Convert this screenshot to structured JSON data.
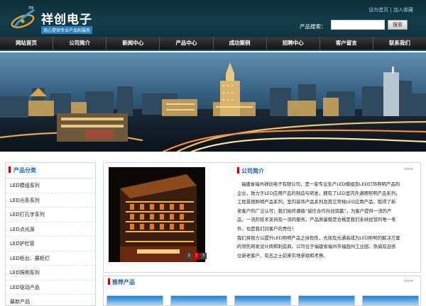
{
  "brand": {
    "name": "祥创电子",
    "slogan": "用心提供专业产品和服务",
    "tm": "TM",
    "logo_icon": "swoosh-logo-icon"
  },
  "top_links": {
    "homepage": "设为首页",
    "separator": "|",
    "favorite": "加入收藏"
  },
  "search": {
    "label": "产品搜索：",
    "placeholder": "",
    "button": "搜索"
  },
  "nav": {
    "items": [
      "网站首页",
      "公司简介",
      "新闻中心",
      "产品中心",
      "成功案例",
      "招聘中心",
      "客户留言",
      "联系我们"
    ]
  },
  "sidebar": {
    "title": "产品分类",
    "items": [
      "LED模组系列",
      "LED光条系列",
      "LED打孔字系列",
      "LED点光源",
      "LED护栏管",
      "LED柜台、展柜灯",
      "LED照明系列",
      "LED驱动产品",
      "最新产品"
    ]
  },
  "about": {
    "title": "公司简介",
    "more": "more",
    "pager": [
      "1",
      "2",
      "3"
    ],
    "active_page": 2,
    "lines": [
      "福建省福州祥创电子有限公司，是一家专业生产LED模组及LED灯饰照明产品的",
      "企业，致力于LED应用产品的制造与研发，拥有了LED室内外通用照明产品系列，",
      "工程景观照明产品系列，室内装饰产品系列及其它常规LED应用产品，取得了新",
      "老客户的广泛认可；我们始终遵循“诚信合作共创双赢”，为客户提供一流的产",
      "品，一流的技术支持及一流的服务。产品质量稳定合格是我们永续经营的唯一条",
      "件，也是我们对客户的责任！",
      "我们将致力以提升LED照明产品之绿色性，光效及光通高成为LED照明的解决方案",
      "的领先研发设计商和制造商。公司位于福建省福州市福园州工业园，热诚欢迎各",
      "位新老客户、有志之士前来实地参观和考察。"
    ]
  },
  "products": {
    "title": "推荐产品",
    "more": "more"
  }
}
